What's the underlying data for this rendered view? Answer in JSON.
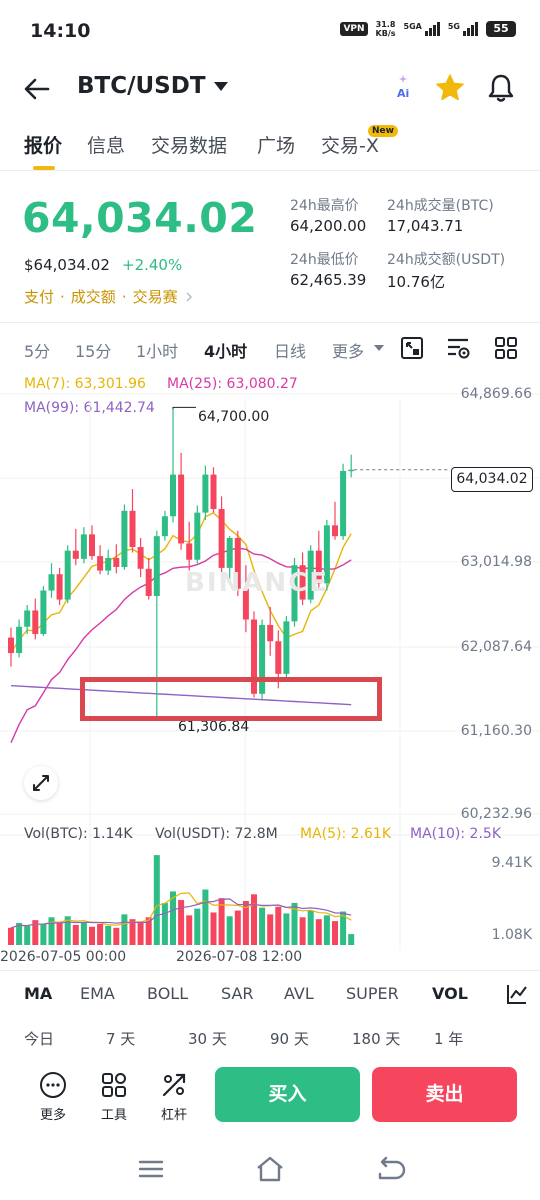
{
  "status_bar": {
    "time": "14:10",
    "vpn": "VPN",
    "net_speed_value": "31.8",
    "net_speed_unit": "KB/s",
    "sig1_label": "5GA",
    "sig2_label": "5G",
    "battery": "55"
  },
  "header": {
    "pair": "BTC/USDT",
    "ai_label": "Ai"
  },
  "tabs": [
    {
      "label": "报价"
    },
    {
      "label": "信息"
    },
    {
      "label": "交易数据"
    },
    {
      "label": "广场"
    },
    {
      "label": "交易-X"
    }
  ],
  "new_badge": "New",
  "price": {
    "last": "64,034.02",
    "usd": "$64,034.02",
    "change": "+2.40%",
    "links": [
      "支付",
      "成交额",
      "交易赛"
    ]
  },
  "stats": {
    "high_label": "24h最高价",
    "high_value": "64,200.00",
    "vol_btc_label": "24h成交量(BTC)",
    "vol_btc_value": "17,043.71",
    "low_label": "24h最低价",
    "low_value": "62,465.39",
    "vol_usdt_label": "24h成交额(USDT)",
    "vol_usdt_value": "10.76亿"
  },
  "intervals": [
    "5分",
    "15分",
    "1小时",
    "4小时",
    "日线",
    "更多"
  ],
  "ma_legend": {
    "ma7": "MA(7): 63,301.96",
    "ma25": "MA(25): 63,080.27",
    "ma99": "MA(99): 61,442.74"
  },
  "price_axis": [
    "64,869.66",
    "63,014.98",
    "62,087.64",
    "61,160.30",
    "60,232.96"
  ],
  "current_price_tag": "64,034.02",
  "high_marker": "64,700.00",
  "low_marker": "61,306.84",
  "watermark": "BINANCE",
  "vol_legend": {
    "btc": "Vol(BTC): 1.14K",
    "usdt": "Vol(USDT): 72.8M",
    "ma5": "MA(5): 2.61K",
    "ma10": "MA(10): 2.5K"
  },
  "vol_axis": [
    "9.41K",
    "1.08K"
  ],
  "dates": [
    "2026-07-05 00:00",
    "2026-07-08 12:00"
  ],
  "indicators": [
    "MA",
    "EMA",
    "BOLL",
    "SAR",
    "AVL",
    "SUPER",
    "VOL"
  ],
  "periods": [
    "今日",
    "7 天",
    "30 天",
    "90 天",
    "180 天",
    "1 年"
  ],
  "bottom": {
    "more": "更多",
    "tools": "工具",
    "leverage": "杠杆",
    "buy": "买入",
    "sell": "卖出"
  },
  "colors": {
    "up": "#2ebd85",
    "down": "#f6465d",
    "accent": "#f0b90b",
    "ma7": "#e8b506",
    "ma25": "#d63aa8",
    "ma99": "#8e63c4"
  },
  "candles": [
    [
      62180,
      62290,
      61860,
      62010
    ],
    [
      62010,
      62380,
      61960,
      62300
    ],
    [
      62300,
      62540,
      62220,
      62480
    ],
    [
      62480,
      62610,
      62160,
      62220
    ],
    [
      62220,
      62750,
      62200,
      62700
    ],
    [
      62700,
      63000,
      62620,
      62880
    ],
    [
      62880,
      62950,
      62540,
      62600
    ],
    [
      62600,
      63200,
      62560,
      63140
    ],
    [
      63140,
      63380,
      62980,
      63050
    ],
    [
      63050,
      63400,
      63000,
      63320
    ],
    [
      63320,
      63420,
      63040,
      63080
    ],
    [
      63080,
      63200,
      62880,
      62920
    ],
    [
      62920,
      63150,
      62870,
      63060
    ],
    [
      63060,
      63210,
      62890,
      62960
    ],
    [
      62960,
      63650,
      62930,
      63580
    ],
    [
      63580,
      63820,
      63120,
      63180
    ],
    [
      63180,
      63280,
      62850,
      62940
    ],
    [
      62940,
      63060,
      62600,
      62640
    ],
    [
      62640,
      63360,
      61306.84,
      63300
    ],
    [
      63300,
      63580,
      63250,
      63520
    ],
    [
      63520,
      64700,
      63450,
      63980
    ],
    [
      63980,
      64220,
      63150,
      63220
    ],
    [
      63220,
      63460,
      62920,
      63040
    ],
    [
      63040,
      63640,
      63000,
      63560
    ],
    [
      63560,
      64080,
      63480,
      63980
    ],
    [
      63980,
      64060,
      63560,
      63600
    ],
    [
      63600,
      63740,
      62900,
      62950
    ],
    [
      62950,
      63300,
      62820,
      63280
    ],
    [
      63280,
      63360,
      62640,
      62720
    ],
    [
      62720,
      62980,
      62240,
      62380
    ],
    [
      62380,
      62470,
      61520,
      61560
    ],
    [
      61560,
      62380,
      61500,
      62320
    ],
    [
      62320,
      62520,
      61980,
      62140
    ],
    [
      62140,
      62260,
      61620,
      61780
    ],
    [
      61780,
      62420,
      61720,
      62360
    ],
    [
      62360,
      63060,
      62300,
      62980
    ],
    [
      62980,
      63120,
      62540,
      62600
    ],
    [
      62600,
      63200,
      62560,
      63140
    ],
    [
      63140,
      63360,
      62700,
      62780
    ],
    [
      62780,
      63480,
      62700,
      63420
    ],
    [
      63420,
      63680,
      63260,
      63300
    ],
    [
      63300,
      64100,
      63260,
      64020
    ],
    [
      64020,
      64200,
      63950,
      64034.02
    ]
  ],
  "volumes": [
    [
      1.8,
      "down"
    ],
    [
      2.3,
      "up"
    ],
    [
      2.0,
      "up"
    ],
    [
      2.6,
      "down"
    ],
    [
      2.2,
      "up"
    ],
    [
      2.9,
      "up"
    ],
    [
      2.3,
      "down"
    ],
    [
      3.0,
      "up"
    ],
    [
      2.1,
      "down"
    ],
    [
      2.4,
      "up"
    ],
    [
      1.9,
      "down"
    ],
    [
      2.2,
      "down"
    ],
    [
      2.0,
      "up"
    ],
    [
      1.8,
      "down"
    ],
    [
      3.2,
      "up"
    ],
    [
      2.7,
      "down"
    ],
    [
      2.4,
      "down"
    ],
    [
      2.9,
      "down"
    ],
    [
      9.4,
      "up"
    ],
    [
      4.4,
      "up"
    ],
    [
      5.6,
      "up"
    ],
    [
      4.7,
      "down"
    ],
    [
      3.1,
      "down"
    ],
    [
      3.8,
      "up"
    ],
    [
      5.8,
      "up"
    ],
    [
      3.4,
      "down"
    ],
    [
      4.9,
      "down"
    ],
    [
      3.0,
      "up"
    ],
    [
      3.6,
      "down"
    ],
    [
      4.6,
      "down"
    ],
    [
      5.3,
      "down"
    ],
    [
      3.9,
      "up"
    ],
    [
      3.2,
      "down"
    ],
    [
      4.0,
      "down"
    ],
    [
      3.3,
      "up"
    ],
    [
      4.4,
      "up"
    ],
    [
      2.9,
      "down"
    ],
    [
      3.6,
      "up"
    ],
    [
      2.7,
      "down"
    ],
    [
      3.1,
      "up"
    ],
    [
      2.5,
      "down"
    ],
    [
      3.5,
      "up"
    ],
    [
      1.14,
      "up"
    ]
  ]
}
